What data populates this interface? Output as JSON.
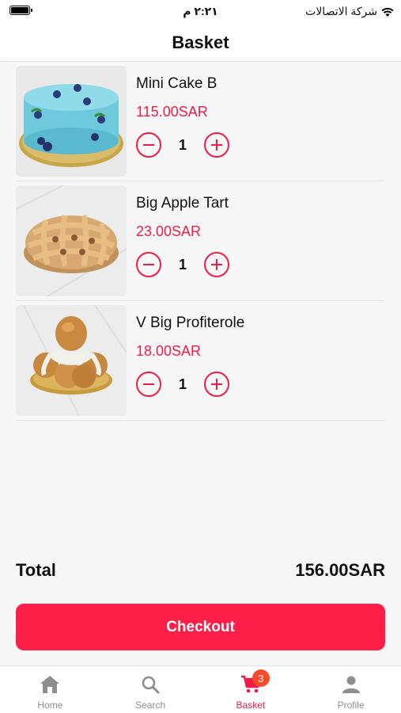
{
  "status_bar": {
    "time": "٢:٢١ م",
    "carrier": "شركة الاتصالات"
  },
  "header": {
    "title": "Basket"
  },
  "items": [
    {
      "name": "Mini Cake B",
      "price": "115.00SAR",
      "quantity": "1",
      "image": "blue-cake-image"
    },
    {
      "name": "Big Apple Tart",
      "price": "23.00SAR",
      "quantity": "1",
      "image": "apple-tart-image"
    },
    {
      "name": "V Big Profiterole",
      "price": "18.00SAR",
      "quantity": "1",
      "image": "profiterole-image"
    }
  ],
  "summary": {
    "total_label": "Total",
    "total_value": "156.00SAR",
    "checkout_label": "Checkout"
  },
  "tabbar": {
    "tabs": [
      {
        "label": "Home",
        "icon": "home-icon"
      },
      {
        "label": "Search",
        "icon": "search-icon"
      },
      {
        "label": "Basket",
        "icon": "cart-icon",
        "badge": "3",
        "active": true
      },
      {
        "label": "Profile",
        "icon": "person-icon"
      }
    ]
  },
  "colors": {
    "accent": "#ef1c47",
    "checkout_bg": "#fe1f48",
    "badge": "#f34b2c"
  }
}
